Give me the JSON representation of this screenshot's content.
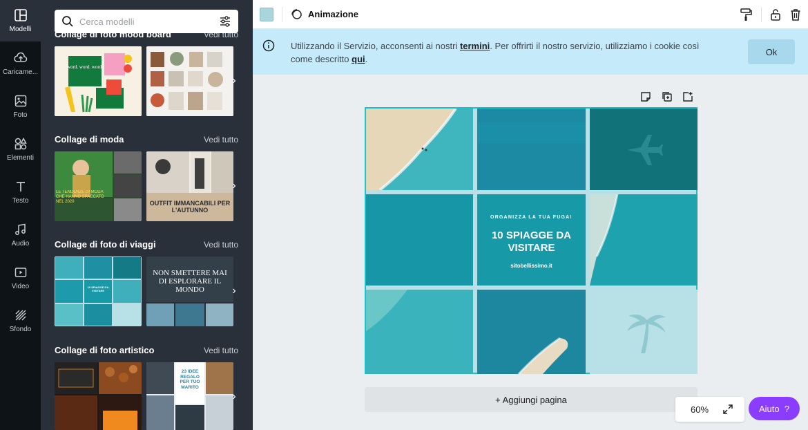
{
  "rail": {
    "items": [
      {
        "label": "Modelli",
        "icon": "templates-icon",
        "active": true
      },
      {
        "label": "Caricame...",
        "icon": "upload-icon"
      },
      {
        "label": "Foto",
        "icon": "photo-icon"
      },
      {
        "label": "Elementi",
        "icon": "elements-icon"
      },
      {
        "label": "Testo",
        "icon": "text-icon"
      },
      {
        "label": "Audio",
        "icon": "audio-icon"
      },
      {
        "label": "Video",
        "icon": "video-icon"
      },
      {
        "label": "Sfondo",
        "icon": "background-icon"
      }
    ]
  },
  "panel": {
    "search_placeholder": "Cerca modelli",
    "sections": [
      {
        "title": "Collage di foto mood board",
        "link": "Vedi tutto"
      },
      {
        "title": "Collage di moda",
        "link": "Vedi tutto"
      },
      {
        "title": "Collage di foto di viaggi",
        "link": "Vedi tutto"
      },
      {
        "title": "Collage di foto artistico",
        "link": "Vedi tutto"
      }
    ],
    "thumb_texts": {
      "wordword": "word. word. word.",
      "moda1": "LE TENDENZE DI MODA CHE HANNO SPACCATO NEL 2020",
      "moda2": "OUTFIT IMMANCABILI PER L'AUTUNNO",
      "viaggi1": "10 SPIAGGE DA VISITARE",
      "viaggi2": "NON SMETTERE MAI DI ESPLORARE IL MONDO",
      "arte2": "23 IDEE REGALO PER TUO MARITO"
    }
  },
  "toolbar": {
    "animation_label": "Animazione",
    "color": "#a8d6dc"
  },
  "banner": {
    "text_before": "Utilizzando il Servizio, acconsenti ai nostri ",
    "link1": "termini",
    "text_middle": ". Per offrirti il nostro servizio, utilizziamo i cookie così come descritto ",
    "link2": "qui",
    "text_end": ".",
    "ok_label": "Ok"
  },
  "design": {
    "kicker": "ORGANIZZA LA TUA FUGA!",
    "headline": "10 SPIAGGE DA VISITARE",
    "site": "sitobellissimo.it"
  },
  "canvas": {
    "add_page_label": "+ Aggiungi pagina",
    "zoom_label": "60%",
    "help_label": "Aiuto",
    "help_icon": "?"
  }
}
